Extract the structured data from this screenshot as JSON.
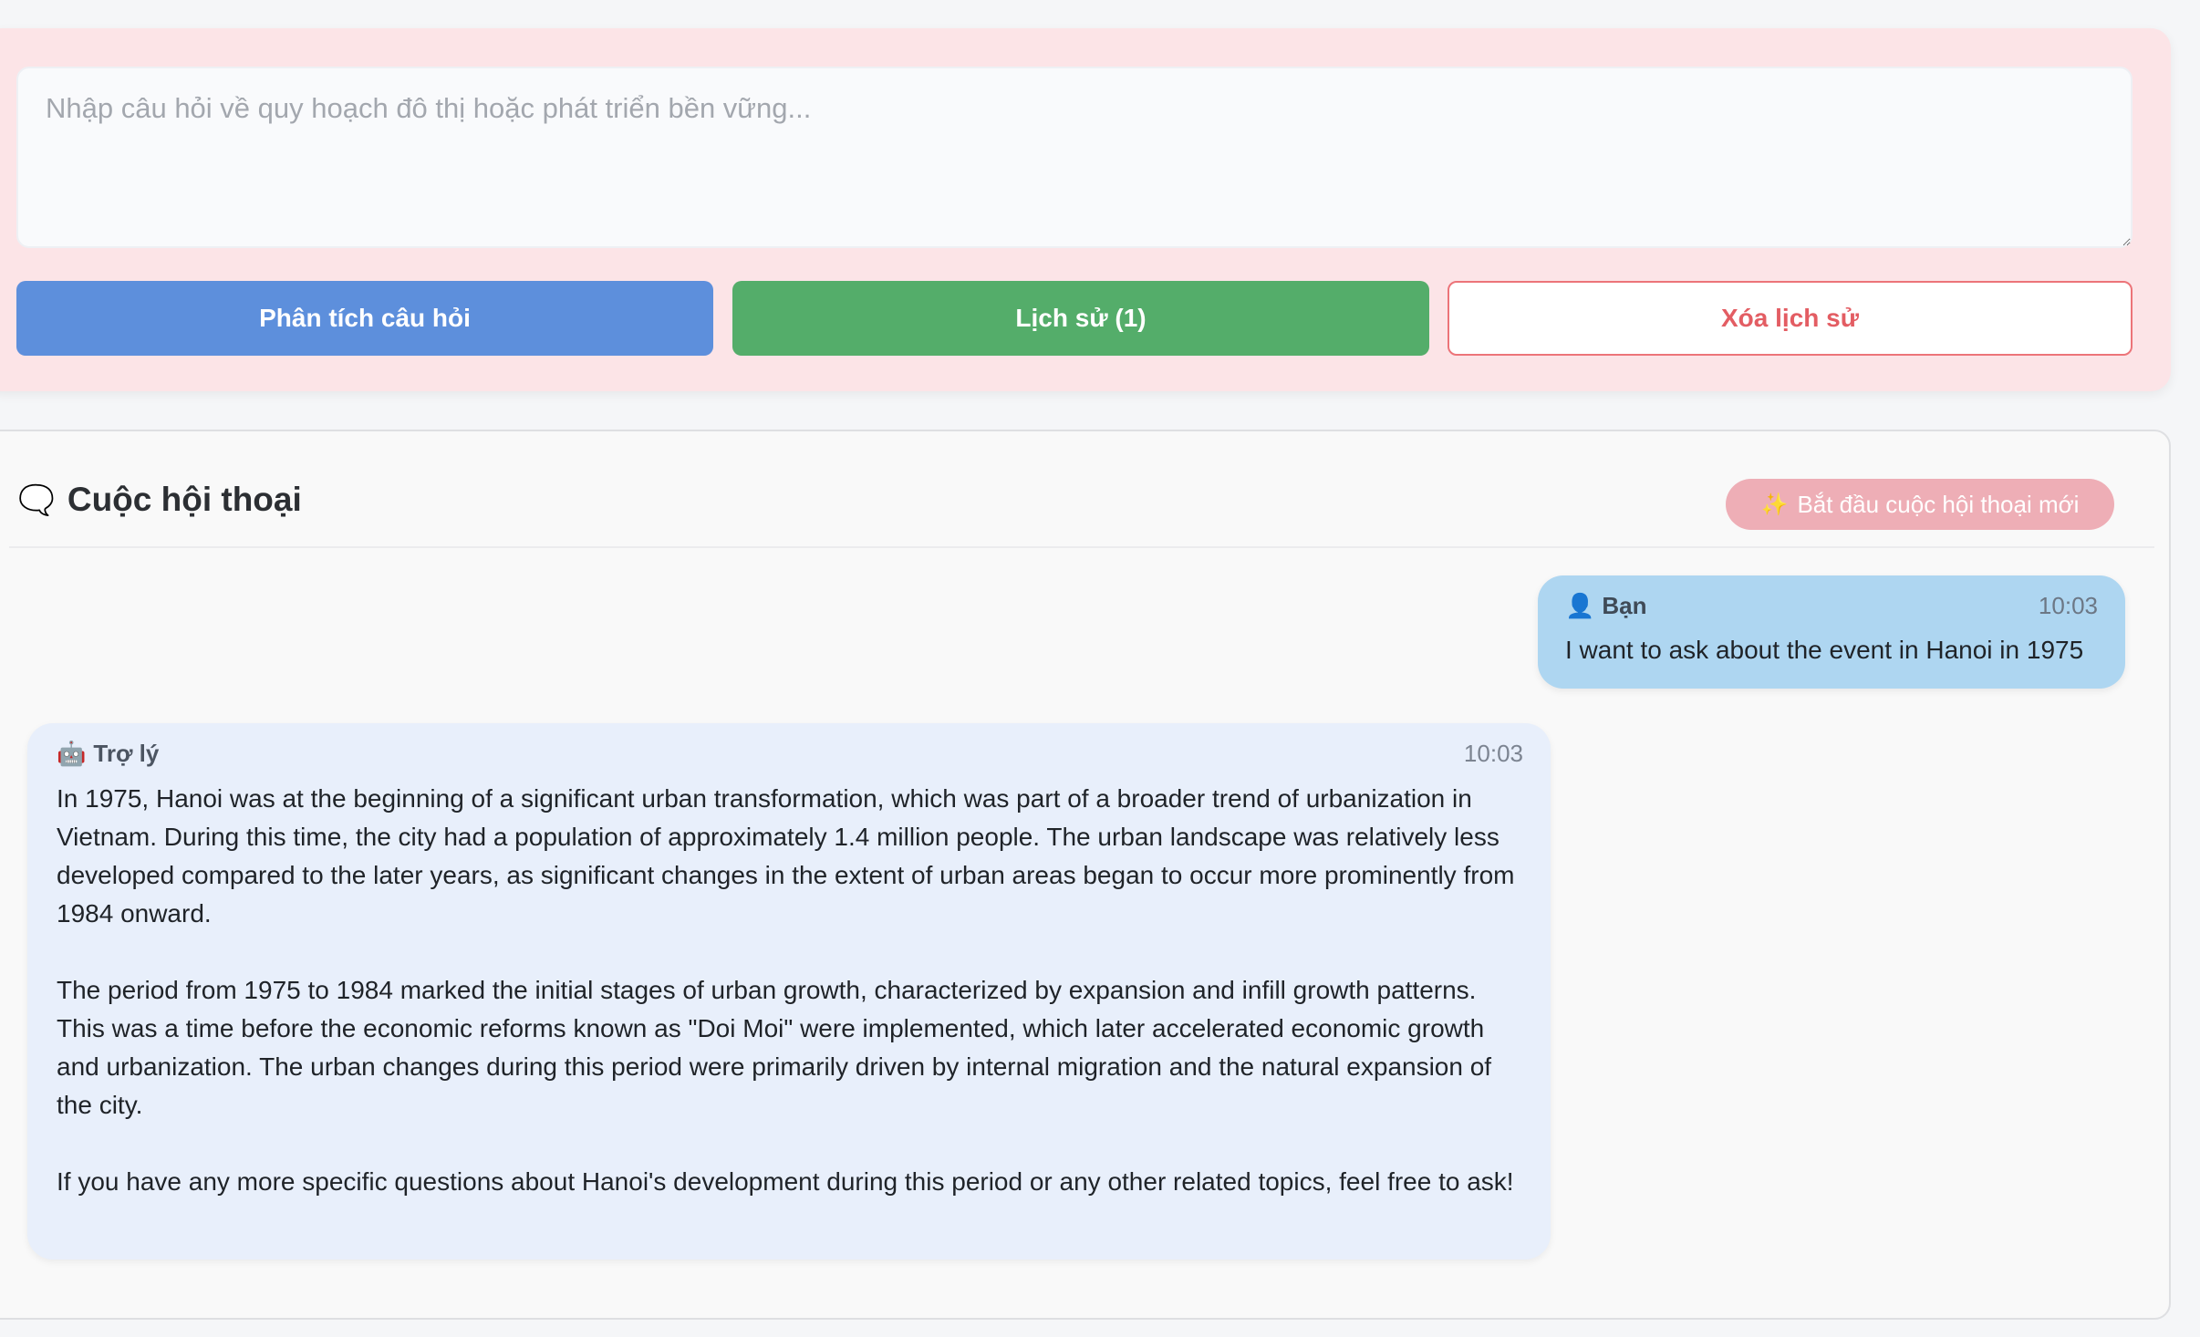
{
  "input": {
    "placeholder": "Nhập câu hỏi về quy hoạch đô thị hoặc phát triển bền vững...",
    "value": ""
  },
  "buttons": {
    "analyze": "Phân tích câu hỏi",
    "history": "Lịch sử (1)",
    "clear": "Xóa lịch sử"
  },
  "chat": {
    "icon": "🗨️",
    "title": "Cuộc hội thoại",
    "new_chat_icon": "✨",
    "new_chat_label": "Bắt đầu cuộc hội thoại mới",
    "messages": [
      {
        "role": "user",
        "icon": "👤",
        "sender": "Bạn",
        "time": "10:03",
        "text": "I want to ask about the event in Hanoi in 1975"
      },
      {
        "role": "assistant",
        "icon": "🤖",
        "sender": "Trợ lý",
        "time": "10:03",
        "paragraphs": [
          "In 1975, Hanoi was at the beginning of a significant urban transformation, which was part of a broader trend of urbanization in Vietnam. During this time, the city had a population of approximately 1.4 million people. The urban landscape was relatively less developed compared to the later years, as significant changes in the extent of urban areas began to occur more prominently from 1984 onward.",
          "The period from 1975 to 1984 marked the initial stages of urban growth, characterized by expansion and infill growth patterns. This was a time before the economic reforms known as \"Doi Moi\" were implemented, which later accelerated economic growth and urbanization. The urban changes during this period were primarily driven by internal migration and the natural expansion of the city.",
          "If you have any more specific questions about Hanoi's development during this period or any other related topics, feel free to ask!"
        ]
      }
    ]
  },
  "colors": {
    "input_panel_bg": "#fce4e7",
    "analyze_button": "#5d8fdc",
    "history_button": "#54ad6a",
    "clear_button_accent": "#e35d63",
    "new_chat_button": "#eeaeb6",
    "user_bubble": "#aed6f1",
    "assistant_bubble": "#e8effb"
  }
}
